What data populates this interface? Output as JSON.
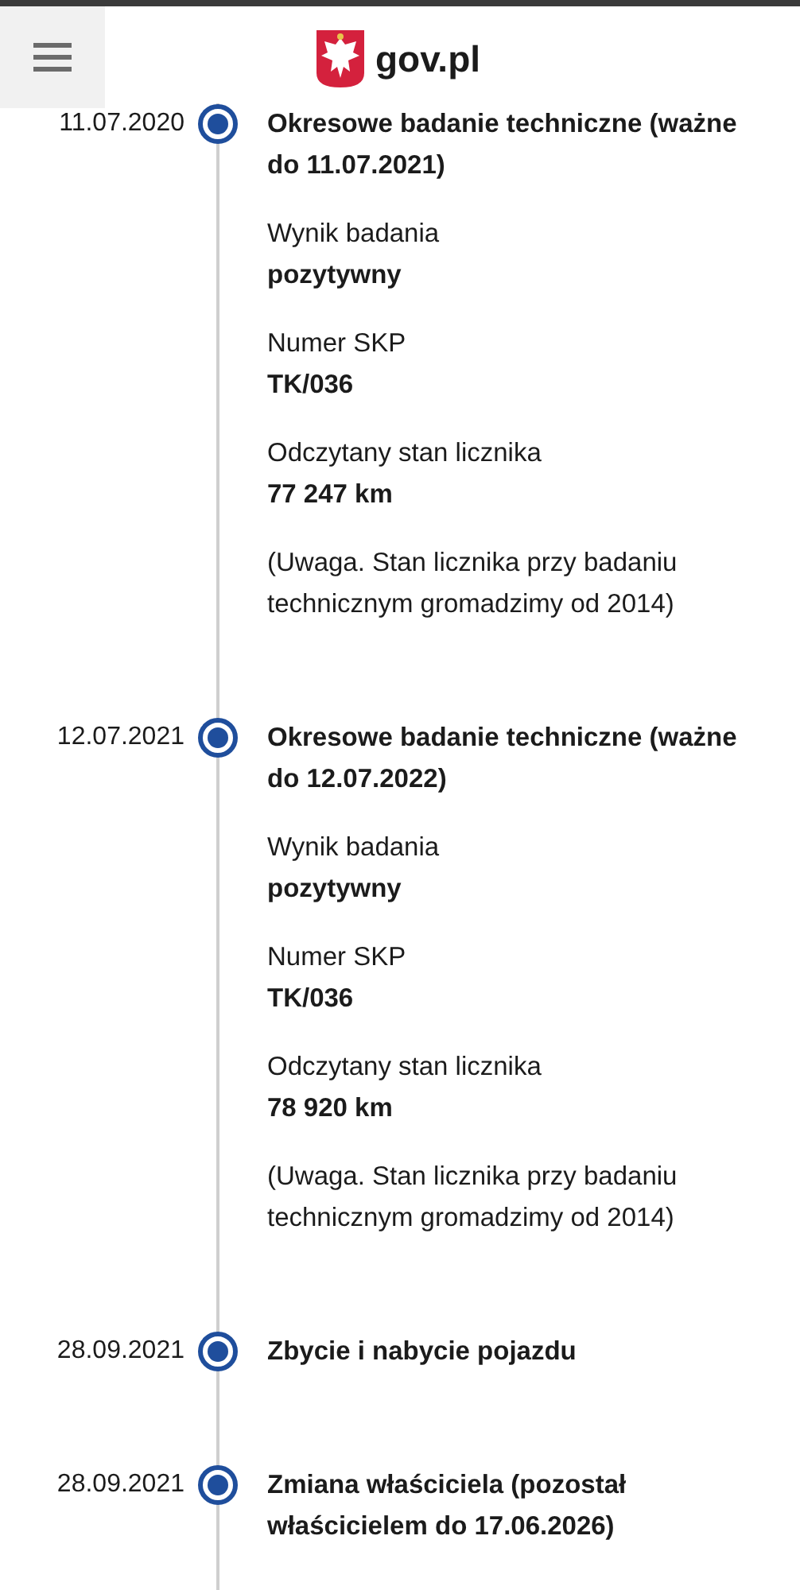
{
  "header": {
    "logo_text": "gov.pl"
  },
  "timeline": [
    {
      "date": "11.07.2020",
      "title": "Okresowe badanie techniczne (ważne do 11.07.2021)",
      "details": [
        {
          "label": "Wynik badania",
          "value": "pozytywny"
        },
        {
          "label": "Numer SKP",
          "value": "TK/036"
        },
        {
          "label": "Odczytany stan licznika",
          "value": "77 247 km"
        }
      ],
      "note": "(Uwaga. Stan licznika przy badaniu technicznym gromadzimy od 2014)"
    },
    {
      "date": "12.07.2021",
      "title": "Okresowe badanie techniczne (ważne do 12.07.2022)",
      "details": [
        {
          "label": "Wynik badania",
          "value": "pozytywny"
        },
        {
          "label": "Numer SKP",
          "value": "TK/036"
        },
        {
          "label": "Odczytany stan licznika",
          "value": "78 920 km"
        }
      ],
      "note": "(Uwaga. Stan licznika przy badaniu technicznym gromadzimy od 2014)"
    },
    {
      "date": "28.09.2021",
      "title": "Zbycie i nabycie pojazdu"
    },
    {
      "date": "28.09.2021",
      "title": "Zmiana właściciela (pozostał właścicielem do 17.06.2026)"
    }
  ]
}
